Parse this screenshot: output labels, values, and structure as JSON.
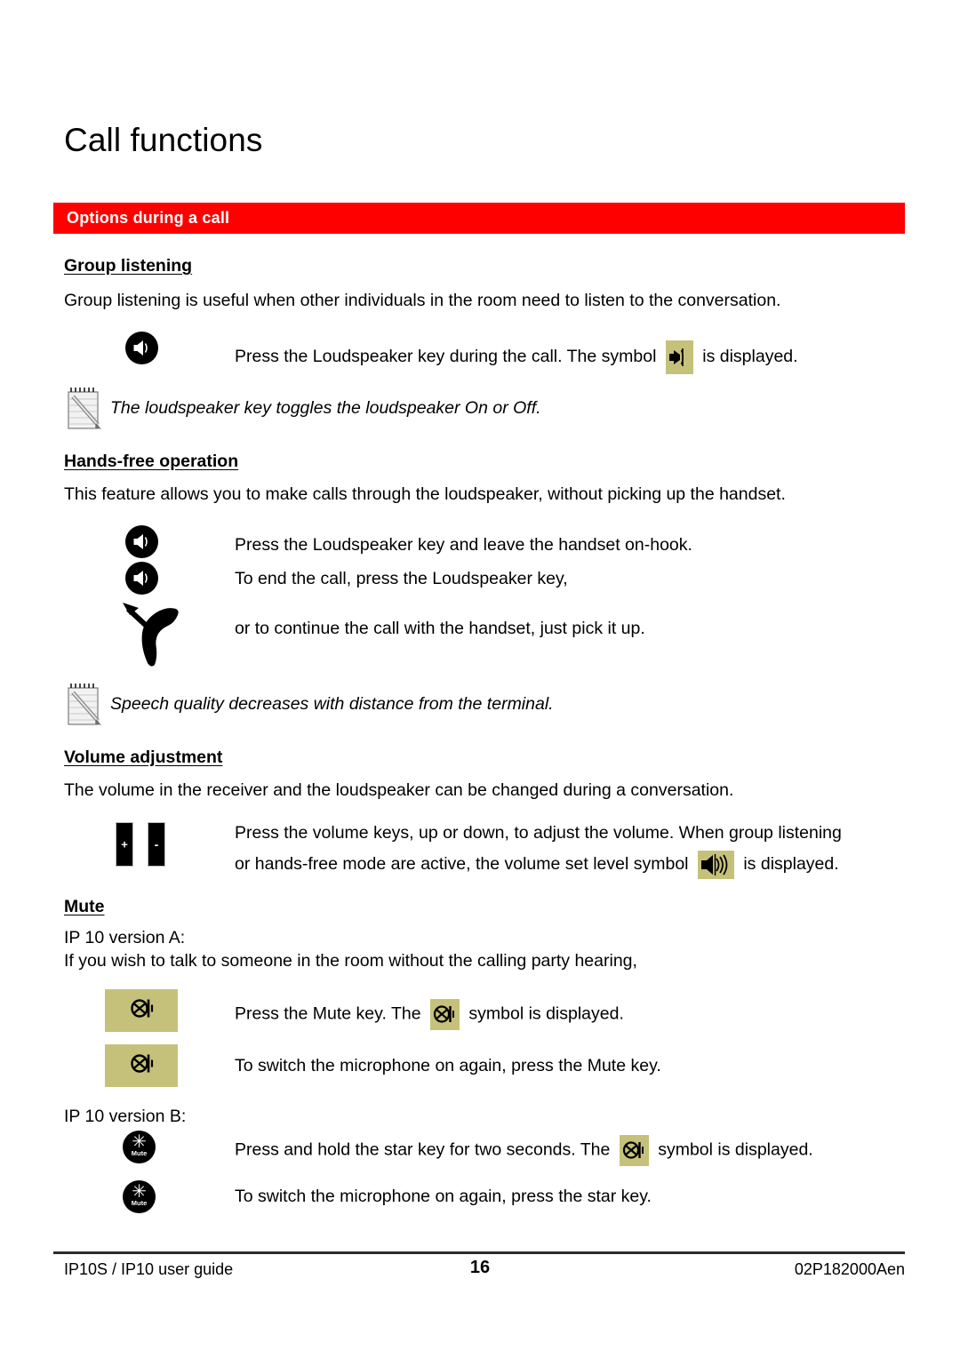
{
  "document": {
    "title": "Call functions",
    "banner": {
      "label": "Options during a call",
      "background_color": "#ff0000",
      "text_color": "#ffffff"
    }
  },
  "sections": {
    "group_listening": {
      "heading": "Group listening",
      "intro": "Group listening is useful when other individuals in the room need to listen to the conversation.",
      "step_text_before": "Press the Loudspeaker key during the call. The symbol",
      "step_text_after": "is displayed.",
      "note": "The loudspeaker key toggles the loudspeaker On or Off."
    },
    "hands_free": {
      "heading": "Hands-free operation",
      "intro": "This feature allows you to make calls through the loudspeaker, without picking up the handset.",
      "step1": "Press the Loudspeaker key and leave the handset on-hook.",
      "step2": "To end the call, press the Loudspeaker key,",
      "step3": "or to continue the call with the handset, just pick it up.",
      "note": "Speech quality decreases with distance from the terminal."
    },
    "volume_adjustment": {
      "heading": "Volume adjustment",
      "intro": "The volume in the receiver and the loudspeaker can be changed during a conversation.",
      "step_line1": "Press the volume keys, up or down, to adjust the volume. When group listening",
      "step_line2_before": "or hands-free mode are active, the volume set level symbol",
      "step_line2_after": "is displayed.",
      "plus_key_label": "+",
      "minus_key_label": "-"
    },
    "mute": {
      "heading": "Mute",
      "version_a_label": "IP 10 version A:",
      "version_a_intro": "If you wish to talk to someone in the room without the calling party hearing,",
      "version_a_step1_before": "Press the Mute key. The",
      "version_a_step1_after": "symbol is displayed.",
      "version_a_step2": "To switch the microphone on again, press the Mute key.",
      "version_b_label": "IP 10 version B:",
      "version_b_step1_before": "Press and hold the star key for two seconds. The",
      "version_b_step1_after": "symbol is displayed.",
      "version_b_step2": "To switch the microphone on again, press the star key.",
      "star_key_caption": "Mute",
      "star_key_glyph": "✳"
    }
  },
  "icons": {
    "loudspeaker_key": "loudspeaker-key-icon",
    "loudspeaker_display_symbol": "loudspeaker-display-symbol",
    "note_pad": "notepad-pencil-icon",
    "handset_pickup": "handset-pickup-icon",
    "volume_keys": "volume-up-down-keys-icon",
    "volume_level_symbol": "volume-level-display-symbol",
    "mute_key": "mute-key-icon",
    "mute_display_symbol": "mute-display-symbol",
    "star_mute_key": "star-mute-key-icon"
  },
  "colors": {
    "banner_red": "#ff0000",
    "lcd_khaki": "#c6c17a",
    "ink_black": "#000000"
  },
  "footer": {
    "left": "IP10S / IP10 user guide",
    "page_number": "16",
    "right": "02P182000Aen"
  }
}
